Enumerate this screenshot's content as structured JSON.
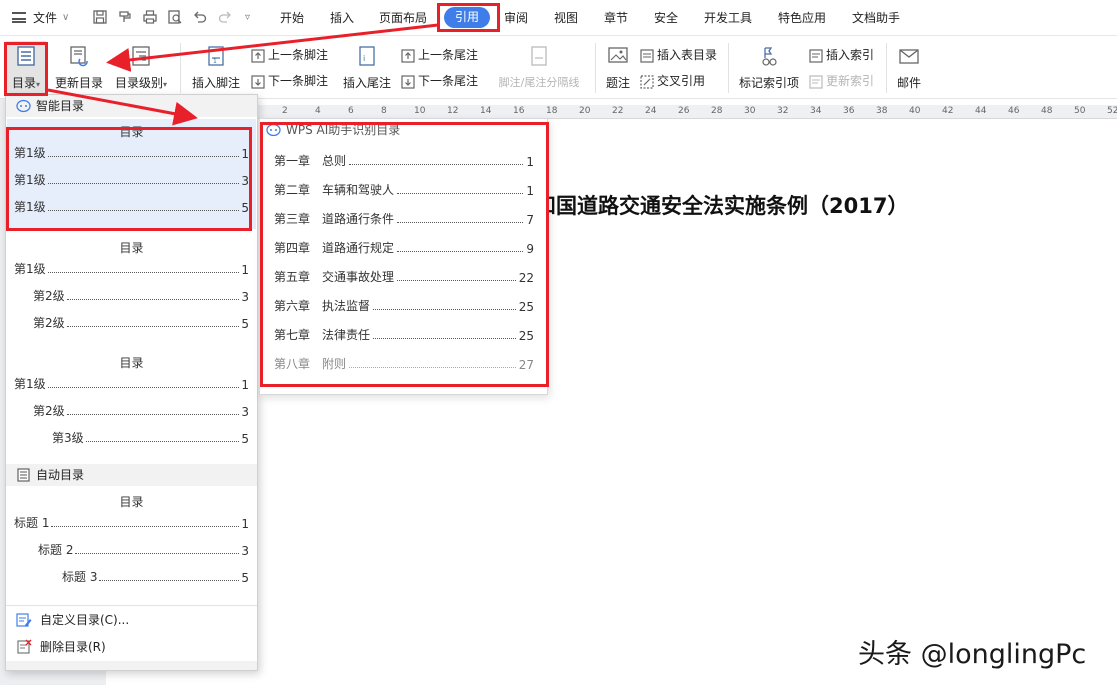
{
  "menubar": {
    "file_label": "文件",
    "tabs": [
      "开始",
      "插入",
      "页面布局",
      "引用",
      "审阅",
      "视图",
      "章节",
      "安全",
      "开发工具",
      "特色应用",
      "文档助手"
    ],
    "active_tab": "引用"
  },
  "ribbon": {
    "toc": "目录",
    "update_toc": "更新目录",
    "toc_level": "目录级别",
    "insert_footnote": "插入脚注",
    "prev_footnote": "上一条脚注",
    "next_footnote": "下一条脚注",
    "insert_endnote": "插入尾注",
    "prev_endnote": "上一条尾注",
    "next_endnote": "下一条尾注",
    "footnote_separator": "脚注/尾注分隔线",
    "caption": "题注",
    "insert_table_of_figures": "插入表目录",
    "cross_reference": "交叉引用",
    "mark_index_entry": "标记索引项",
    "insert_index": "插入索引",
    "update_index": "更新索引",
    "mail": "邮件"
  },
  "ruler": [
    "2",
    "4",
    "6",
    "8",
    "10",
    "12",
    "14",
    "16",
    "18",
    "20",
    "22",
    "24",
    "26",
    "28",
    "30",
    "32",
    "34",
    "36",
    "38",
    "40",
    "42",
    "44",
    "46",
    "48",
    "50",
    "52"
  ],
  "document": {
    "title_fragment": "和国道路交通安全法实施条例（2017）"
  },
  "dropdown": {
    "smart_section": "智能目录",
    "auto_section": "自动目录",
    "cards": [
      {
        "title": "目录",
        "lines": [
          {
            "label": "第1级",
            "page": "1"
          },
          {
            "label": "第1级",
            "page": "3"
          },
          {
            "label": "第1级",
            "page": "5"
          }
        ]
      },
      {
        "title": "目录",
        "lines": [
          {
            "label": "第1级",
            "page": "1"
          },
          {
            "label": "第2级",
            "page": "3"
          },
          {
            "label": "第2级",
            "page": "5"
          }
        ]
      },
      {
        "title": "目录",
        "lines": [
          {
            "label": "第1级",
            "page": "1"
          },
          {
            "label": "第2级",
            "page": "3"
          },
          {
            "label": "第3级",
            "page": "5"
          }
        ]
      },
      {
        "title": "目录",
        "lines": [
          {
            "label": "标题 1",
            "page": "1"
          },
          {
            "label": "标题 2",
            "page": "3"
          },
          {
            "label": "标题 3",
            "page": "5"
          }
        ]
      }
    ],
    "custom_toc": "自定义目录(C)...",
    "delete_toc": "删除目录(R)"
  },
  "preview": {
    "header": "WPS AI助手识别目录",
    "chapters": [
      {
        "num": "第一章",
        "name": "总则",
        "page": "1"
      },
      {
        "num": "第二章",
        "name": "车辆和驾驶人",
        "page": "1"
      },
      {
        "num": "第三章",
        "name": "道路通行条件",
        "page": "7"
      },
      {
        "num": "第四章",
        "name": "道路通行规定",
        "page": "9"
      },
      {
        "num": "第五章",
        "name": "交通事故处理",
        "page": "22"
      },
      {
        "num": "第六章",
        "name": "执法监督",
        "page": "25"
      },
      {
        "num": "第七章",
        "name": "法律责任",
        "page": "25"
      },
      {
        "num": "第八章",
        "name": "附则",
        "page": "27"
      }
    ]
  },
  "watermark": "头条 @longlingPc",
  "colors": {
    "accent": "#3f7ee8",
    "annotation": "#e8202a",
    "selection": "#e6eefb"
  }
}
